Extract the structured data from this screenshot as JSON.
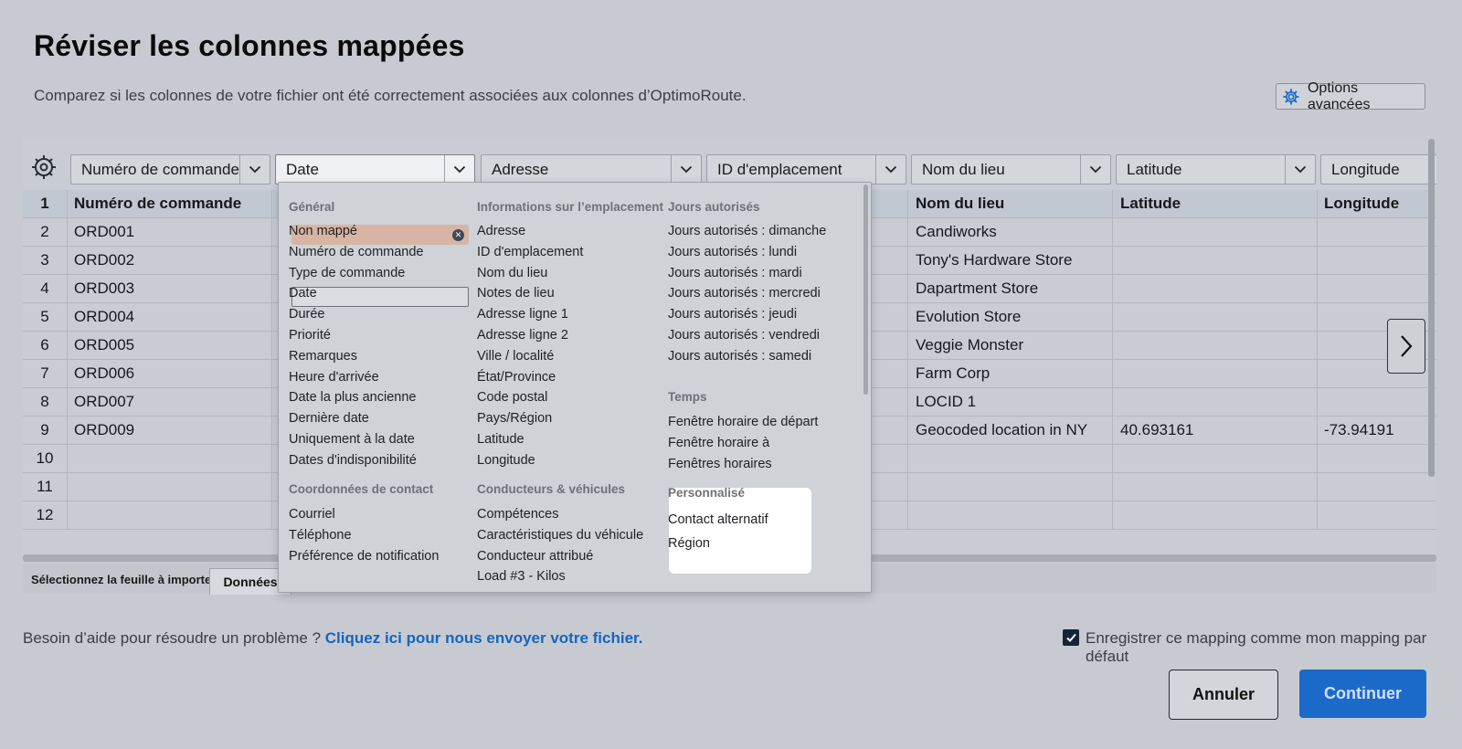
{
  "page": {
    "title": "Réviser les colonnes mappées",
    "subtitle": "Comparez si les colonnes de votre fichier ont été correctement associées aux colonnes d’OptimoRoute.",
    "advanced_options": "Options avancées",
    "icons": {
      "settings": "gear-icon",
      "columns": "column-settings-icon",
      "dropdown": "chevron-down-icon",
      "next": "chevron-right-icon",
      "checkbox": "checkmark-icon",
      "clear": "close-icon"
    }
  },
  "column_selects": [
    {
      "label": "Numéro de commande"
    },
    {
      "label": "Date"
    },
    {
      "label": "Adresse"
    },
    {
      "label": "ID d'emplacement"
    },
    {
      "label": "Nom du lieu"
    },
    {
      "label": "Latitude"
    },
    {
      "label": "Longitude"
    }
  ],
  "table": {
    "header": {
      "num": "1",
      "c1": "Numéro de commande",
      "c5": "Nom du lieu",
      "c6": "Latitude",
      "c7": "Longitude"
    },
    "rows": [
      {
        "num": "2",
        "c1": "ORD001",
        "c5": "Candiworks",
        "c6": "",
        "c7": ""
      },
      {
        "num": "3",
        "c1": "ORD002",
        "c5": "Tony's Hardware Store",
        "c6": "",
        "c7": ""
      },
      {
        "num": "4",
        "c1": "ORD003",
        "c5": "Dapartment Store",
        "c6": "",
        "c7": ""
      },
      {
        "num": "5",
        "c1": "ORD004",
        "c5": "Evolution Store",
        "c6": "",
        "c7": ""
      },
      {
        "num": "6",
        "c1": "ORD005",
        "c5": "Veggie Monster",
        "c6": "",
        "c7": ""
      },
      {
        "num": "7",
        "c1": "ORD006",
        "c5": "Farm Corp",
        "c6": "",
        "c7": ""
      },
      {
        "num": "8",
        "c1": "ORD007",
        "c5": "LOCID 1",
        "c6": "",
        "c7": ""
      },
      {
        "num": "9",
        "c1": "ORD009",
        "c5": "Geocoded location in NY",
        "c6": "40.693161",
        "c7": "-73.94191"
      },
      {
        "num": "10",
        "c1": "",
        "c5": "",
        "c6": "",
        "c7": ""
      },
      {
        "num": "11",
        "c1": "",
        "c5": "",
        "c6": "",
        "c7": ""
      },
      {
        "num": "12",
        "c1": "",
        "c5": "",
        "c6": "",
        "c7": ""
      }
    ]
  },
  "sheet": {
    "label": "Sélectionnez la feuille à importer :",
    "tab": "Données"
  },
  "dropdown": {
    "general": {
      "heading": "Général",
      "items": [
        "Non mappé",
        "Numéro de commande",
        "Type de commande",
        "Date",
        "Durée",
        "Priorité",
        "Remarques",
        "Heure d'arrivée",
        "Date la plus ancienne",
        "Dernière date",
        "Uniquement à la date",
        "Dates d'indisponibilité"
      ]
    },
    "contact": {
      "heading": "Coordonnées de contact",
      "items": [
        "Courriel",
        "Téléphone",
        "Préférence de notification"
      ]
    },
    "location": {
      "heading": "Informations sur l’emplacement",
      "items": [
        "Adresse",
        "ID d'emplacement",
        "Nom du lieu",
        "Notes de lieu",
        "Adresse ligne 1",
        "Adresse ligne 2",
        "Ville / localité",
        "État/Province",
        "Code postal",
        "Pays/Région",
        "Latitude",
        "Longitude"
      ]
    },
    "drivers": {
      "heading": "Conducteurs & véhicules",
      "items": [
        "Compétences",
        "Caractéristiques du véhicule",
        "Conducteur attribué",
        "Load #3 - Kilos"
      ]
    },
    "days": {
      "heading": "Jours autorisés",
      "items": [
        "Jours autorisés : dimanche",
        "Jours autorisés : lundi",
        "Jours autorisés : mardi",
        "Jours autorisés : mercredi",
        "Jours autorisés : jeudi",
        "Jours autorisés : vendredi",
        "Jours autorisés : samedi"
      ]
    },
    "time": {
      "heading": "Temps",
      "items": [
        "Fenêtre horaire de départ",
        "Fenêtre horaire à",
        "Fenêtres horaires"
      ]
    },
    "custom": {
      "heading": "Personnalisé",
      "items": [
        "Contact alternatif",
        "Région"
      ]
    }
  },
  "footer": {
    "help_text": "Besoin d’aide pour résoudre un problème ?",
    "help_link": "Cliquez ici pour nous envoyer votre fichier.",
    "save_default": "Enregistrer ce mapping comme mon mapping par défaut",
    "save_default_checked": true,
    "cancel": "Annuler",
    "continue": "Continuer"
  },
  "colors": {
    "accent": "#1b6ac9",
    "selected_item": "#d8b4a4"
  }
}
